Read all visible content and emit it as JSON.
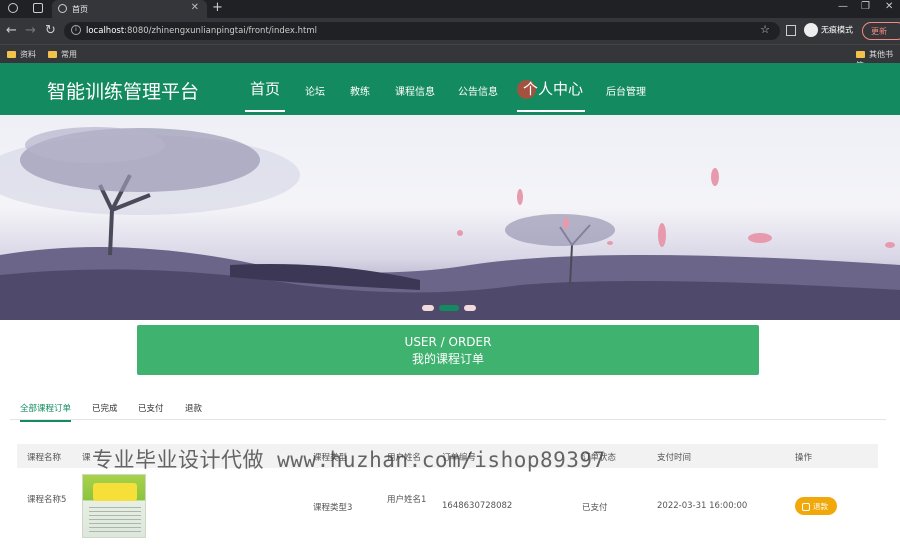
{
  "browser": {
    "tab_title": "首页",
    "url_host": "localhost",
    "url_rest": ":8080/zhinengxunlianpingtai/front/index.html",
    "incognito_label": "无痕模式",
    "update_label": "更新",
    "bookmarks": [
      "资料",
      "常用",
      "其他书签"
    ]
  },
  "header": {
    "logo": "智能训练管理平台",
    "menu": [
      "首页",
      "论坛",
      "教练",
      "课程信息",
      "公告信息",
      "个人中心",
      "后台管理"
    ],
    "active_index": 0
  },
  "banner": {
    "slide_count": 3,
    "active_slide": 2
  },
  "order_box": {
    "title_en": "USER / ORDER",
    "title_cn": "我的课程订单"
  },
  "subtabs": [
    "全部课程订单",
    "已完成",
    "已支付",
    "退款"
  ],
  "table": {
    "headers": [
      "课程名称",
      "课",
      "课程类型",
      "用户姓名",
      "订单编号",
      "订单状态",
      "支付时间",
      "操作"
    ],
    "rows": [
      {
        "course_name": "课程名称5",
        "course_type": "课程类型3",
        "user_name": "用户姓名1",
        "order_no": "1648630728082",
        "status": "已支付",
        "time": "2022-03-31 16:00:00",
        "action": "退款"
      }
    ]
  },
  "watermark": "专业毕业设计代做 www.huzhan.com/ishop89397",
  "colors": {
    "primary": "#138a5f",
    "order_box": "#3fb26f",
    "refund": "#f1a80a"
  }
}
